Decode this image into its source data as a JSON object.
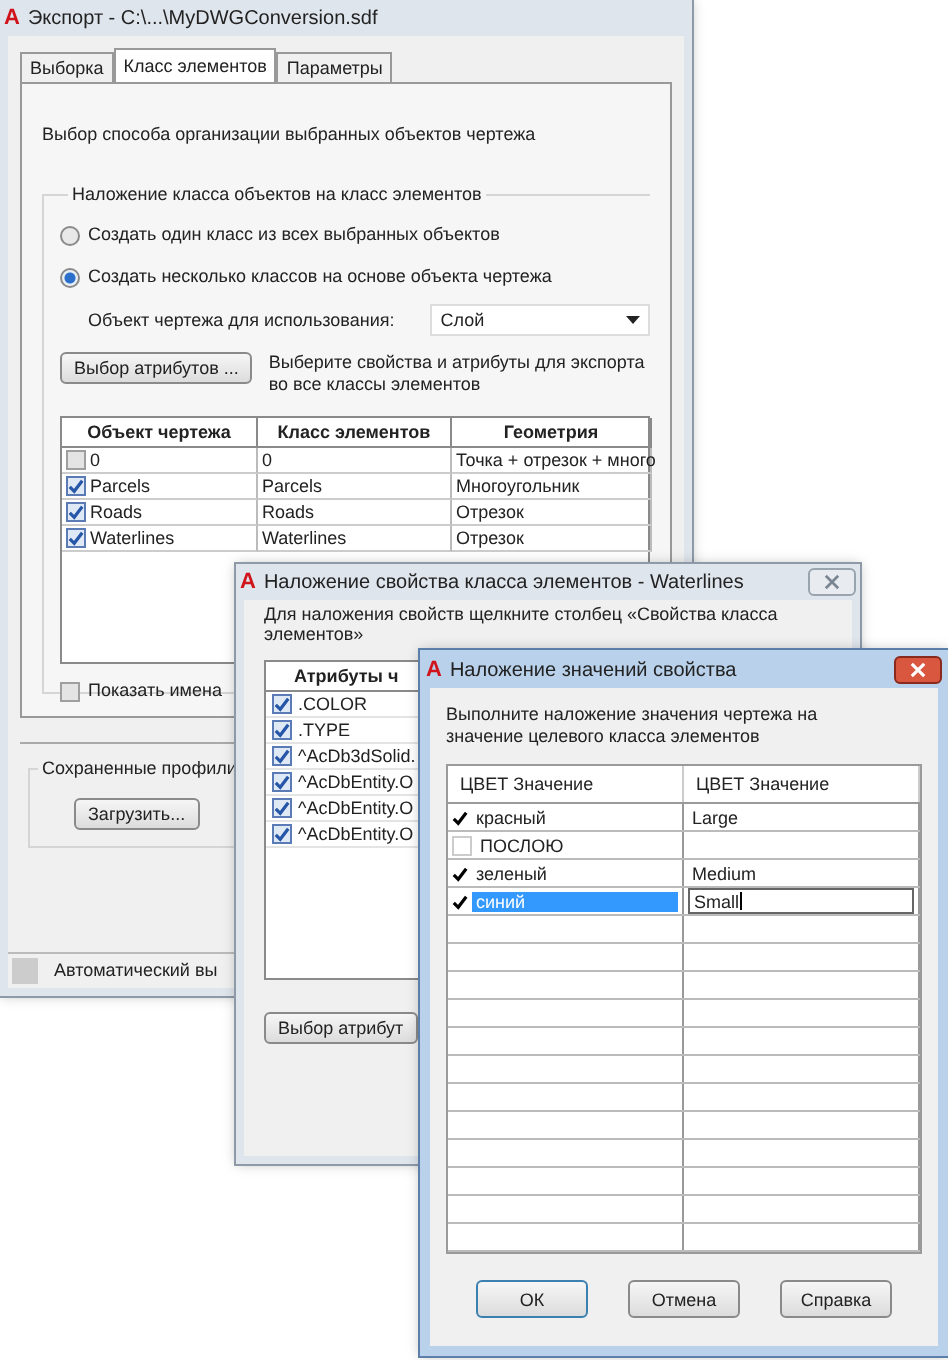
{
  "export_window": {
    "icon_letter": "A",
    "title": "Экспорт - C:\\...\\MyDWGConversion.sdf",
    "tabs": [
      {
        "label": "Выборка",
        "selected": false
      },
      {
        "label": "Класс элементов",
        "selected": true
      },
      {
        "label": "Параметры",
        "selected": false
      }
    ],
    "description": "Выбор способа организации выбранных объектов чертежа",
    "group_title": "Наложение класса объектов на класс элементов",
    "radios": [
      {
        "label": "Создать один класс из всех выбранных объектов",
        "selected": false
      },
      {
        "label": "Создать несколько классов на основе объекта чертежа",
        "selected": true
      }
    ],
    "object_label": "Объект чертежа для использования:",
    "object_value": "Слой",
    "attributes_button": "Выбор атрибутов ...",
    "attributes_hint": "Выберите свойства и атрибуты для экспорта во все классы элементов",
    "table": {
      "columns": [
        "Объект чертежа",
        "Класс элементов",
        "Геометрия"
      ],
      "rows": [
        {
          "object": "0",
          "class": "0",
          "geometry": "Точка + отрезок + много",
          "checked": false
        },
        {
          "object": "Parcels",
          "class": "Parcels",
          "geometry": "Многоугольник",
          "checked": true
        },
        {
          "object": "Roads",
          "class": "Roads",
          "geometry": "Отрезок",
          "checked": true
        },
        {
          "object": "Waterlines",
          "class": "Waterlines",
          "geometry": "Отрезок",
          "checked": true
        }
      ]
    },
    "show_names": {
      "label": "Показать имена",
      "checked": false
    },
    "profiles_title": "Сохраненные профили",
    "load_button": "Загрузить...",
    "status": "Автоматический вы"
  },
  "property_window": {
    "icon_letter": "A",
    "title": "Наложение свойства класса элементов - Waterlines",
    "description": "Для наложения свойств щелкните столбец «Свойства класса элементов»",
    "column": "Атрибуты ч",
    "rows": [
      {
        "label": ".COLOR",
        "checked": true
      },
      {
        "label": ".TYPE",
        "checked": true
      },
      {
        "label": "^AcDb3dSolid.",
        "checked": true
      },
      {
        "label": "^AcDbEntity.O",
        "checked": true
      },
      {
        "label": "^AcDbEntity.O",
        "checked": true
      },
      {
        "label": "^AcDbEntity.O",
        "checked": true
      }
    ],
    "button": "Выбор атрибут"
  },
  "value_window": {
    "icon_letter": "A",
    "title": "Наложение значений свойства",
    "description": "Выполните наложение значения чертежа на значение целевого класса элементов",
    "columns": [
      "ЦВЕТ Значение",
      "ЦВЕТ Значение"
    ],
    "rows": [
      {
        "source": "красный",
        "target": "Large",
        "checked": true,
        "selected": false
      },
      {
        "source": "ПОСЛОЮ",
        "checked": false,
        "selected": false
      },
      {
        "source": "зеленый",
        "target": "Medium",
        "checked": true,
        "selected": false
      },
      {
        "source": "синий",
        "target": "Small",
        "checked": true,
        "selected": true
      }
    ],
    "buttons": [
      "ОК",
      "Отмена",
      "Справка"
    ]
  }
}
